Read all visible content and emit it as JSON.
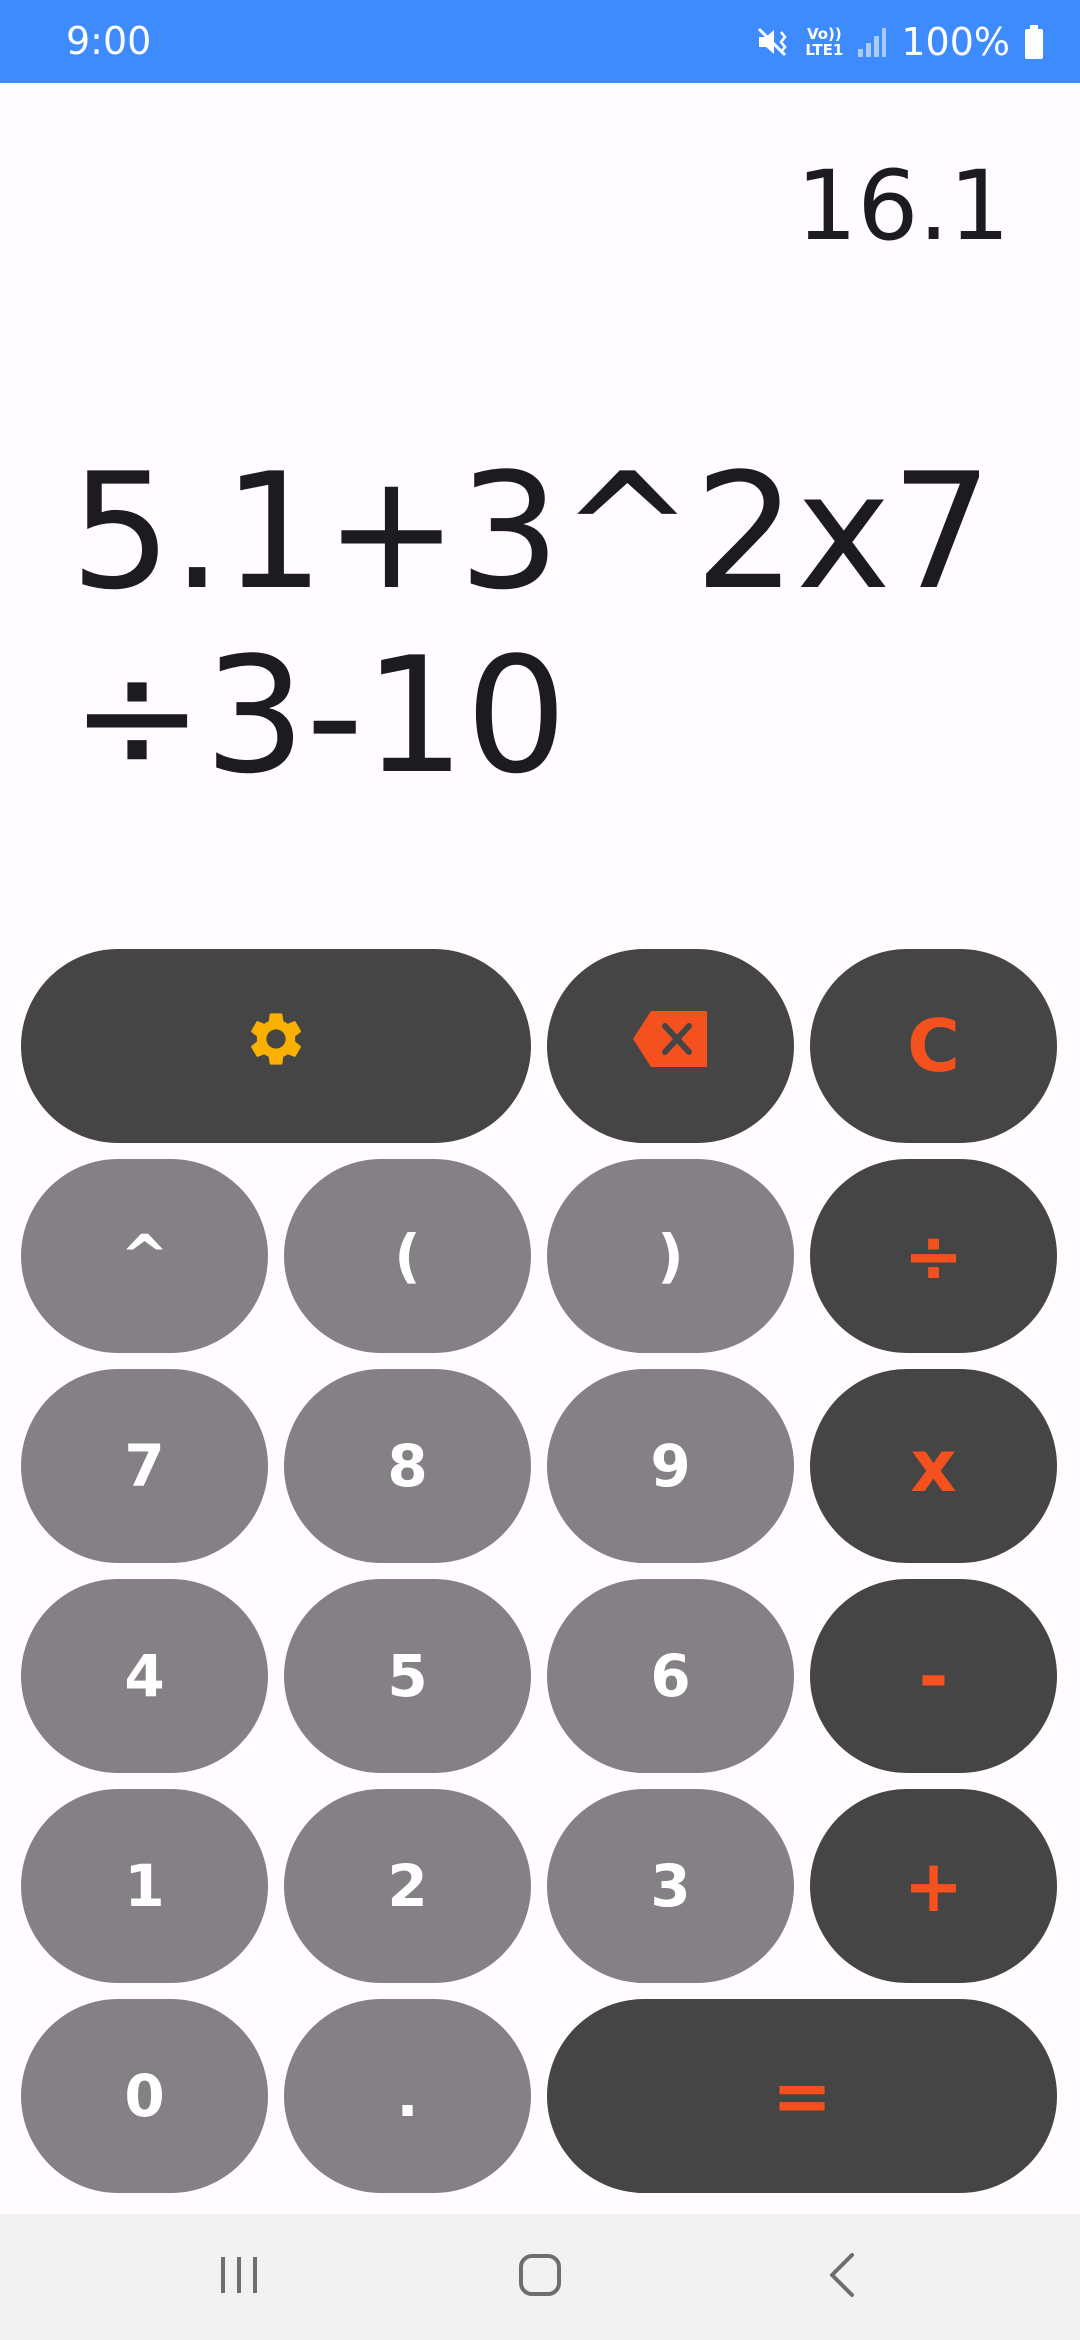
{
  "status_bar": {
    "time": "9:00",
    "network_label_top": "Vo))",
    "network_label_bottom": "LTE1",
    "battery_percent": "100%",
    "icons": [
      "mute-vibrate-icon",
      "volte-icon",
      "signal-icon",
      "battery-icon"
    ]
  },
  "display": {
    "result": "16.1",
    "expression": "5.1+3^2x7÷3-10"
  },
  "keypad": {
    "settings_icon": "gear-icon",
    "backspace_icon": "backspace-icon",
    "clear": "C",
    "caret": "^",
    "open_paren": "(",
    "close_paren": ")",
    "divide": "÷",
    "seven": "7",
    "eight": "8",
    "nine": "9",
    "multiply": "x",
    "four": "4",
    "five": "5",
    "six": "6",
    "minus": "-",
    "one": "1",
    "two": "2",
    "three": "3",
    "plus": "+",
    "zero": "0",
    "decimal": ".",
    "equals": "="
  },
  "colors": {
    "status_bar": "#3d8bfd",
    "key_light": "#858085",
    "key_dark": "#454545",
    "accent_orange": "#f4511e",
    "gear_yellow": "#f9b000"
  },
  "nav_bar": {
    "icons": [
      "recents-icon",
      "home-icon",
      "back-icon"
    ]
  }
}
